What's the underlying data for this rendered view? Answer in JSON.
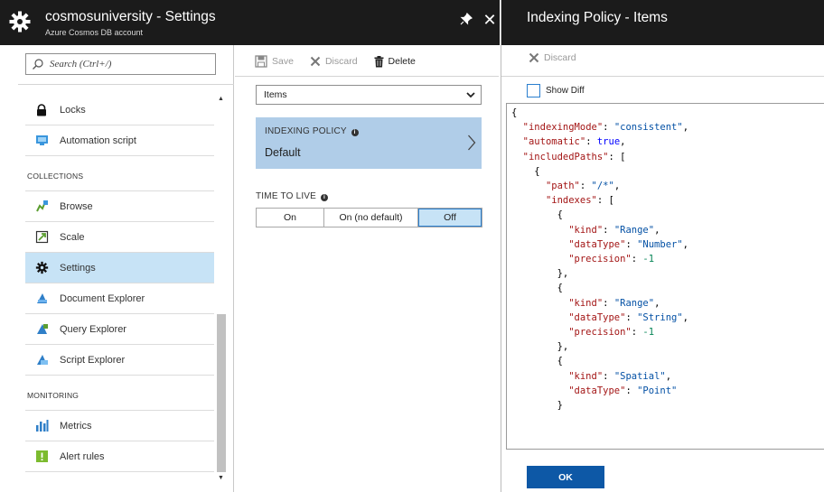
{
  "left_blade": {
    "title": "cosmosuniversity - Settings",
    "subtitle": "Azure Cosmos DB account",
    "pin_glyph": "✦",
    "close_glyph": "✕"
  },
  "search": {
    "placeholder": "Search (Ctrl+/)",
    "value": ""
  },
  "menu": {
    "items_top": [
      {
        "label": "Locks",
        "icon": "lock-icon"
      },
      {
        "label": "Automation script",
        "icon": "automation-script-icon"
      }
    ],
    "collections_header": "COLLECTIONS",
    "collections": [
      {
        "label": "Browse",
        "icon": "browse-icon"
      },
      {
        "label": "Scale",
        "icon": "scale-icon"
      },
      {
        "label": "Settings",
        "icon": "gear-icon",
        "active": true
      },
      {
        "label": "Document Explorer",
        "icon": "document-explorer-icon"
      },
      {
        "label": "Query Explorer",
        "icon": "query-explorer-icon"
      },
      {
        "label": "Script Explorer",
        "icon": "script-explorer-icon"
      }
    ],
    "monitoring_header": "MONITORING",
    "monitoring": [
      {
        "label": "Metrics",
        "icon": "metrics-icon"
      },
      {
        "label": "Alert rules",
        "icon": "alert-rules-icon"
      }
    ]
  },
  "settings_toolbar": {
    "save": "Save",
    "discard": "Discard",
    "delete": "Delete"
  },
  "collection_select": {
    "selected": "Items"
  },
  "indexing_policy": {
    "label": "INDEXING POLICY",
    "value": "Default"
  },
  "ttl": {
    "label": "TIME TO LIVE",
    "options": [
      "On",
      "On (no default)",
      "Off"
    ],
    "selected": "Off"
  },
  "right_blade": {
    "title": "Indexing Policy - Items",
    "discard": "Discard",
    "show_diff": "Show Diff",
    "show_diff_checked": false,
    "ok": "OK"
  },
  "json_lines": [
    "{",
    "  \"indexingMode\": \"consistent\",",
    "  \"automatic\": true,",
    "  \"includedPaths\": [",
    "    {",
    "      \"path\": \"/*\",",
    "      \"indexes\": [",
    "        {",
    "          \"kind\": \"Range\",",
    "          \"dataType\": \"Number\",",
    "          \"precision\": -1",
    "        },",
    "        {",
    "          \"kind\": \"Range\",",
    "          \"dataType\": \"String\",",
    "          \"precision\": -1",
    "        },",
    "        {",
    "          \"kind\": \"Spatial\",",
    "          \"dataType\": \"Point\"",
    "        }"
  ],
  "colors": {
    "header_bg": "#1b1b1b",
    "selected_bg": "#c7e3f6",
    "policy_tile_bg": "#b0cde8",
    "primary_button": "#0d58a6",
    "json_key": "#a31515",
    "json_string": "#0451a5",
    "json_number": "#098658",
    "json_keyword": "#0000ff"
  }
}
